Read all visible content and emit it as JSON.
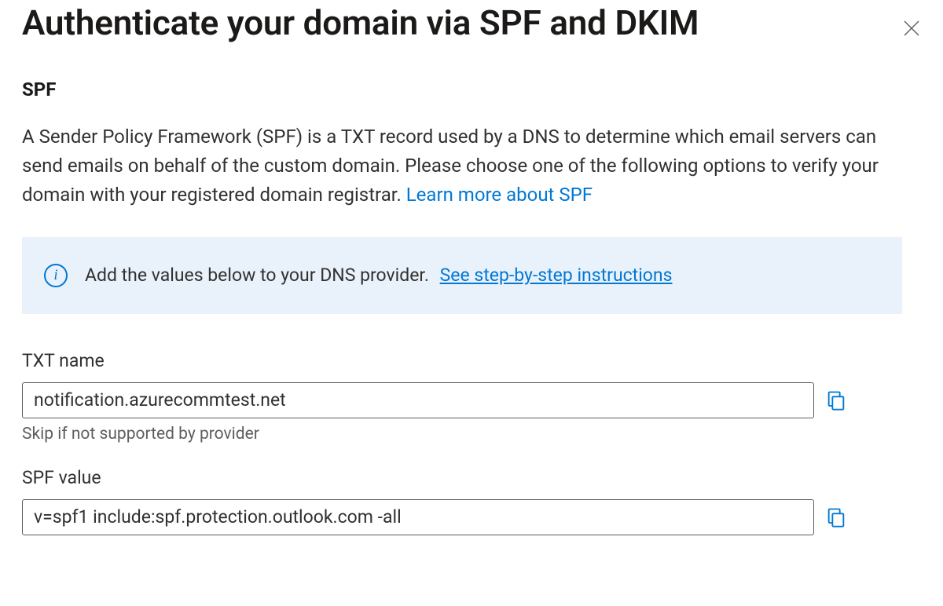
{
  "header": {
    "title": "Authenticate your domain via SPF and DKIM"
  },
  "spf": {
    "heading": "SPF",
    "description_pre_link": "A Sender Policy Framework (SPF) is a TXT record used by a DNS to determine which email servers can send emails on behalf of the custom domain. Please choose one of the following options to verify your domain with your registered domain registrar. ",
    "learn_more_label": "Learn more about SPF",
    "info_pre_link": "Add the values below to your DNS provider.",
    "info_link_label": "See step-by-step instructions",
    "txt_name_label": "TXT name",
    "txt_name_value": "notification.azurecommtest.net",
    "txt_name_hint": "Skip if not supported by provider",
    "spf_value_label": "SPF value",
    "spf_value_value": "v=spf1 include:spf.protection.outlook.com -all"
  }
}
